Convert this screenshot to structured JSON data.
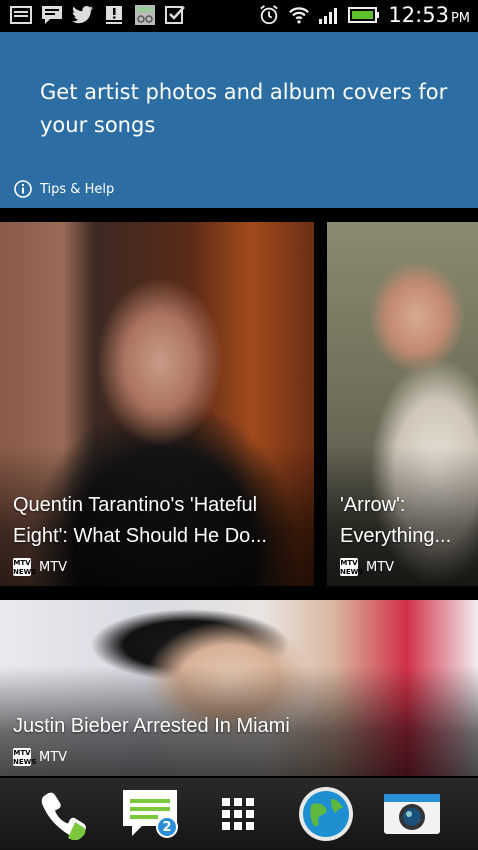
{
  "status_bar": {
    "time": "12:53",
    "ampm": "PM",
    "left_icons": [
      "image-icon",
      "message-icon",
      "twitter-icon",
      "alert-icon",
      "app-icon",
      "checklist-icon"
    ],
    "right_icons": [
      "alarm-icon",
      "wifi-icon",
      "signal-icon",
      "battery-icon"
    ]
  },
  "tips_card": {
    "message": "Get artist photos and album covers for your songs",
    "help_label": "Tips & Help"
  },
  "news": [
    {
      "headline": "Quentin Tarantino's 'Hateful Eight': What Should He Do...",
      "source": "MTV"
    },
    {
      "headline": "'Arrow': Everything...",
      "source": "MTV"
    },
    {
      "headline": "Justin Bieber Arrested In Miami",
      "source": "MTV"
    }
  ],
  "mtv_logo_text": "MTV NEWS",
  "dock": {
    "items": [
      "phone-icon",
      "messages-icon",
      "apps-grid-icon",
      "browser-icon",
      "camera-icon"
    ],
    "messages_badge": "2"
  },
  "colors": {
    "tips_bg": "#2c6ea3",
    "badge": "#2a8fd6",
    "phone_green": "#7cc83c"
  }
}
